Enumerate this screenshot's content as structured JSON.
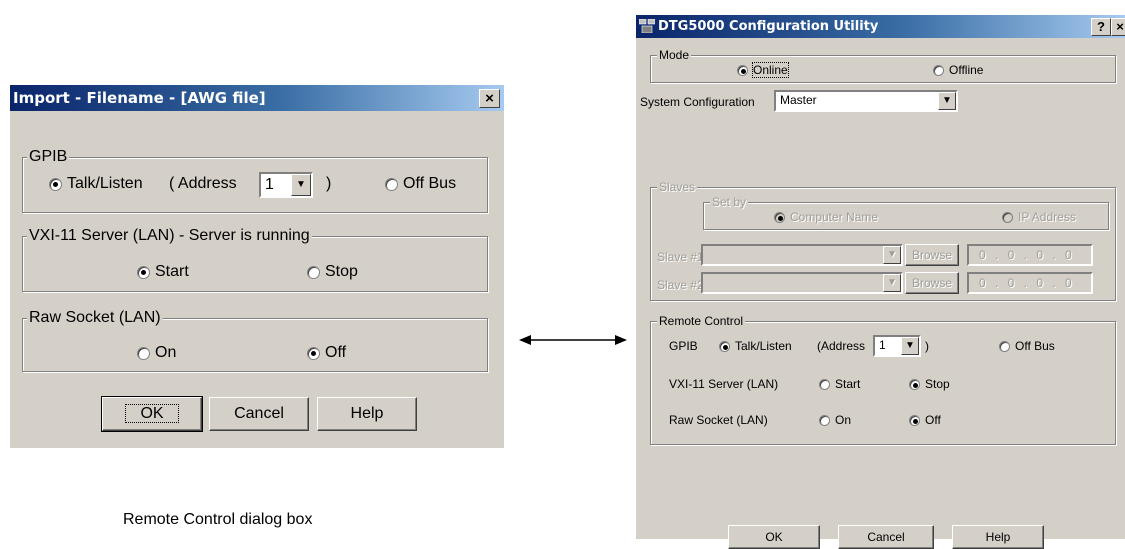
{
  "left_dialog": {
    "title": "Import - Filename - [AWG file]",
    "close_label": "×",
    "gpib": {
      "legend": "GPIB",
      "talk_listen": "Talk/Listen",
      "address_label": "( Address",
      "address_value": "1",
      "address_close": ")",
      "off_bus": "Off Bus"
    },
    "vxi": {
      "legend": "VXI-11 Server (LAN) - Server is running",
      "start": "Start",
      "stop": "Stop"
    },
    "raw_socket": {
      "legend": "Raw Socket (LAN)",
      "on": "On",
      "off": "Off"
    },
    "buttons": {
      "ok": "OK",
      "cancel": "Cancel",
      "help": "Help"
    }
  },
  "caption": "Remote Control dialog box",
  "right_dialog": {
    "title": "DTG5000 Configuration Utility",
    "help_label": "?",
    "close_label": "×",
    "mode": {
      "legend": "Mode",
      "online": "Online",
      "offline": "Offline"
    },
    "system_config": {
      "label": "System Configuration",
      "value": "Master"
    },
    "slaves": {
      "legend": "Slaves",
      "set_by": {
        "legend": "Set by",
        "computer_name": "Computer Name",
        "ip_address": "IP Address"
      },
      "slave1": {
        "label": "Slave #1",
        "browse": "Browse",
        "ip": "0 . 0 . 0 . 0"
      },
      "slave2": {
        "label": "Slave #2",
        "browse": "Browse",
        "ip": "0 . 0 . 0 . 0"
      }
    },
    "remote_control": {
      "legend": "Remote Control",
      "gpib_label": "GPIB",
      "talk_listen": "Talk/Listen",
      "address_label": "(Address",
      "address_value": "1",
      "address_close": ")",
      "off_bus": "Off Bus",
      "vxi_label": "VXI-11 Server (LAN)",
      "start": "Start",
      "stop": "Stop",
      "raw_label": "Raw Socket (LAN)",
      "on": "On",
      "off": "Off"
    },
    "buttons": {
      "ok": "OK",
      "cancel": "Cancel",
      "help": "Help"
    }
  }
}
